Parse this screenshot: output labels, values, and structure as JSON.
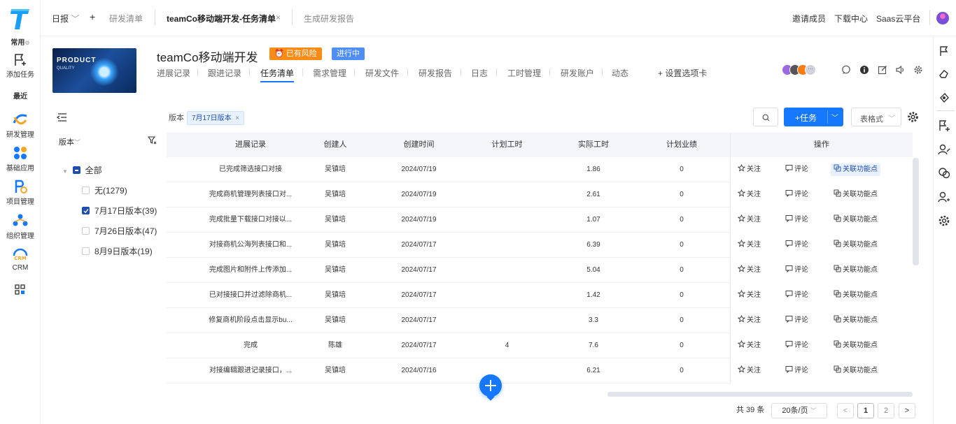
{
  "nav": {
    "common_label": "常用",
    "add_task": "添加任务",
    "recent": "最近",
    "items": [
      "研发管理",
      "基础应用",
      "项目管理",
      "组织管理",
      "CRM"
    ]
  },
  "topbar": {
    "daily": "日报",
    "plus": "+",
    "tabs": [
      "研发清单",
      "teamCo移动端开发-任务清单",
      "生成研发报告"
    ],
    "tab_close": "×",
    "right_links": [
      "邀请成员",
      "下载中心",
      "Saas云平台"
    ]
  },
  "project": {
    "cover_text": "PRODUCT",
    "cover_sub": "QUALITY",
    "title": "teamCo移动端开发",
    "risk_tag": "已有风险",
    "status_tag": "进行中",
    "tabs": [
      "进展记录",
      "跟进记录",
      "任务清单",
      "需求管理",
      "研发文件",
      "研发报告",
      "日志",
      "工时管理",
      "研发账户",
      "动态"
    ],
    "active_tab": "任务清单",
    "settings_tab": "设置选项卡"
  },
  "filter": {
    "version_label": "版本",
    "chip": "7月17日版本",
    "chip_close": "×",
    "view_select": "表格式",
    "add_task_btn": "+任务"
  },
  "tree": {
    "header": "版本",
    "all": "全部",
    "items": [
      {
        "label": "无(1279)",
        "checked": false
      },
      {
        "label": "7月17日版本(39)",
        "checked": true
      },
      {
        "label": "7月26日版本(47)",
        "checked": false
      },
      {
        "label": "8月9日版本(19)",
        "checked": false
      }
    ]
  },
  "table": {
    "headers": [
      "进展记录",
      "创建人",
      "创建时间",
      "计划工时",
      "实际工时",
      "计划业绩",
      "操作"
    ],
    "rows": [
      {
        "title": "已完成筛选接口对接",
        "creator": "吴镇培",
        "date": "2024/07/19",
        "plan": "",
        "actual": "1.86",
        "perf": "0"
      },
      {
        "title": "完成商机管理列表接口对...",
        "creator": "吴镇培",
        "date": "2024/07/19",
        "plan": "",
        "actual": "2.61",
        "perf": "0"
      },
      {
        "title": "完成批量下载接口对接以...",
        "creator": "吴镇培",
        "date": "2024/07/19",
        "plan": "",
        "actual": "1.07",
        "perf": "0"
      },
      {
        "title": "对接商机公海列表接口和...",
        "creator": "吴镇培",
        "date": "2024/07/17",
        "plan": "",
        "actual": "6.39",
        "perf": "0"
      },
      {
        "title": "完成图片和附件上传添加...",
        "creator": "吴镇培",
        "date": "2024/07/17",
        "plan": "",
        "actual": "5.04",
        "perf": "0"
      },
      {
        "title": "已对接接口并过滤除商机...",
        "creator": "吴镇培",
        "date": "2024/07/17",
        "plan": "",
        "actual": "1.42",
        "perf": "0"
      },
      {
        "title": "修复商机阶段点击显示bu...",
        "creator": "吴镇培",
        "date": "2024/07/17",
        "plan": "",
        "actual": "3.3",
        "perf": "0"
      },
      {
        "title": "完成",
        "creator": "陈雄",
        "date": "2024/07/17",
        "plan": "4",
        "actual": "7.6",
        "perf": "0"
      },
      {
        "title": "对接编辑跟进记录接口，...",
        "creator": "吴镇培",
        "date": "2024/07/16",
        "plan": "",
        "actual": "6.21",
        "perf": "0"
      }
    ],
    "ops": {
      "follow": "关注",
      "comment": "评论",
      "link": "关联功能点"
    }
  },
  "pagination": {
    "total": "共 39 条",
    "page_size": "20条/页",
    "prev": "<",
    "next": ">",
    "pages": [
      "1",
      "2"
    ],
    "current": "1"
  },
  "colors": {
    "primary": "#1677ff",
    "risk": "#fa8c16",
    "status": "#4f8ef7",
    "navy": "#1f4db0"
  }
}
